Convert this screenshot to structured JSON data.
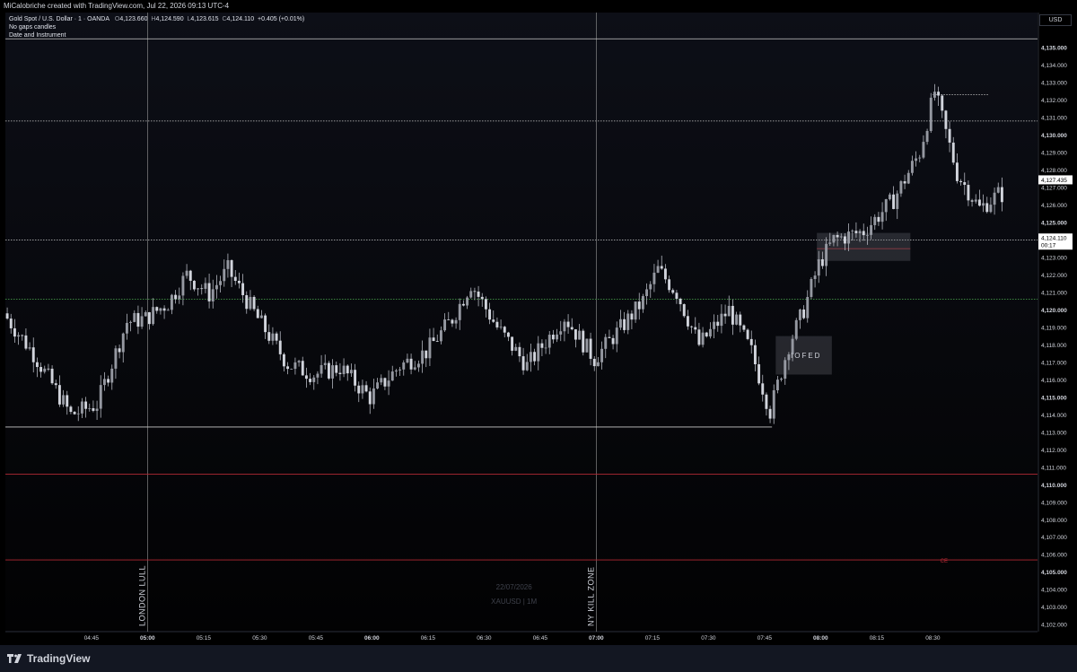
{
  "header": {
    "credit": "MiCalobriche created with TradingView.com, Jul 22, 2026 09:13 UTC-4"
  },
  "legend": {
    "symbol": "Gold Spot / U.S. Dollar · 1 · OANDA",
    "open_label": "O",
    "open": "4,123.660",
    "high_label": "H",
    "high": "4,124.590",
    "low_label": "L",
    "low": "4,123.615",
    "close_label": "C",
    "close": "4,124.110",
    "change": "+0.405 (+0.01%)",
    "line2": "No gaps candles",
    "line3": "Date and Instrument"
  },
  "price_axis": {
    "currency": "USD",
    "current_price": "4,124.110",
    "countdown": "00:17",
    "price_badge_a": "4,127.435",
    "price_badge_b": "4,127.435"
  },
  "footer": {
    "brand": "TradingView"
  },
  "colors": {
    "candle": "#b2b5be",
    "red_level": "#b22833",
    "green_level": "#4caf50",
    "white_level": "#c8c8c8"
  },
  "chart_data": {
    "type": "candlestick",
    "instrument": "XAUUSD",
    "timeframe": "1M",
    "date": "22/07/2026",
    "watermark_line1": "22/07/2026",
    "watermark_line2": "XAUUSD | 1M",
    "ylim": [
      4101.6,
      4137.0
    ],
    "xlim": [
      "04:22",
      "08:58"
    ],
    "y_ticks": [
      {
        "v": 4135,
        "label": "4,135.000",
        "bold": true
      },
      {
        "v": 4134,
        "label": "4,134.000"
      },
      {
        "v": 4133,
        "label": "4,133.000"
      },
      {
        "v": 4132,
        "label": "4,132.000"
      },
      {
        "v": 4131,
        "label": "4,131.000"
      },
      {
        "v": 4130,
        "label": "4,130.000",
        "bold": true
      },
      {
        "v": 4129,
        "label": "4,129.000"
      },
      {
        "v": 4128,
        "label": "4,128.000"
      },
      {
        "v": 4127,
        "label": "4,127.000"
      },
      {
        "v": 4126,
        "label": "4,126.000"
      },
      {
        "v": 4125,
        "label": "4,125.000",
        "bold": true
      },
      {
        "v": 4123,
        "label": "4,123.000"
      },
      {
        "v": 4122,
        "label": "4,122.000"
      },
      {
        "v": 4121,
        "label": "4,121.000"
      },
      {
        "v": 4120,
        "label": "4,120.000",
        "bold": true
      },
      {
        "v": 4119,
        "label": "4,119.000"
      },
      {
        "v": 4118,
        "label": "4,118.000"
      },
      {
        "v": 4117,
        "label": "4,117.000"
      },
      {
        "v": 4116,
        "label": "4,116.000"
      },
      {
        "v": 4115,
        "label": "4,115.000",
        "bold": true
      },
      {
        "v": 4114,
        "label": "4,114.000"
      },
      {
        "v": 4113,
        "label": "4,113.000"
      },
      {
        "v": 4112,
        "label": "4,112.000"
      },
      {
        "v": 4111,
        "label": "4,111.000"
      },
      {
        "v": 4110,
        "label": "4,110.000",
        "bold": true
      },
      {
        "v": 4109,
        "label": "4,109.000"
      },
      {
        "v": 4108,
        "label": "4,108.000"
      },
      {
        "v": 4107,
        "label": "4,107.000"
      },
      {
        "v": 4106,
        "label": "4,106.000"
      },
      {
        "v": 4105,
        "label": "4,105.000",
        "bold": true
      },
      {
        "v": 4104,
        "label": "4,104.000"
      },
      {
        "v": 4103,
        "label": "4,103.000"
      },
      {
        "v": 4102,
        "label": "4,102.000"
      }
    ],
    "x_ticks": [
      {
        "t": "04:45",
        "label": "04:45"
      },
      {
        "t": "05:00",
        "label": "05:00",
        "bold": true
      },
      {
        "t": "05:15",
        "label": "05:15"
      },
      {
        "t": "05:30",
        "label": "05:30"
      },
      {
        "t": "05:45",
        "label": "05:45"
      },
      {
        "t": "06:00",
        "label": "06:00",
        "bold": true
      },
      {
        "t": "06:15",
        "label": "06:15"
      },
      {
        "t": "06:30",
        "label": "06:30"
      },
      {
        "t": "06:45",
        "label": "06:45"
      },
      {
        "t": "07:00",
        "label": "07:00",
        "bold": true
      },
      {
        "t": "07:15",
        "label": "07:15"
      },
      {
        "t": "07:30",
        "label": "07:30"
      },
      {
        "t": "07:45",
        "label": "07:45"
      },
      {
        "t": "08:00",
        "label": "08:00",
        "bold": true
      },
      {
        "t": "08:15",
        "label": "08:15"
      },
      {
        "t": "08:30",
        "label": "08:30"
      }
    ],
    "horizontal_levels": [
      {
        "v": 4135.5,
        "color": "white",
        "from": "04:22",
        "to": "08:58"
      },
      {
        "v": 4130.8,
        "color": "white",
        "style": "dotted",
        "from": "04:22",
        "to": "08:58"
      },
      {
        "v": 4124.0,
        "color": "white",
        "style": "dotted",
        "from": "04:22",
        "to": "08:58"
      },
      {
        "v": 4120.6,
        "color": "green",
        "style": "dotted",
        "from": "04:22",
        "to": "08:58"
      },
      {
        "v": 4113.3,
        "color": "white",
        "from": "04:22",
        "to": "07:47"
      },
      {
        "v": 4110.6,
        "color": "red",
        "from": "04:22",
        "to": "08:58"
      },
      {
        "v": 4105.7,
        "color": "red",
        "from": "04:22",
        "to": "08:58"
      },
      {
        "v": 4132.3,
        "color": "white",
        "style": "dotted",
        "from": "08:30",
        "to": "08:45"
      },
      {
        "v": 4123.5,
        "color": "red",
        "from": "07:59",
        "to": "08:24"
      }
    ],
    "session_lines": [
      {
        "t": "05:00",
        "label": "LONDON LULL"
      },
      {
        "t": "07:00",
        "label": "NY KILL ZONE"
      }
    ],
    "boxes": [
      {
        "label": "IOFED",
        "t0": "07:48",
        "t1": "08:03",
        "v0": 4116.3,
        "v1": 4118.5
      },
      {
        "label": "",
        "t0": "07:59",
        "t1": "08:24",
        "v0": 4122.8,
        "v1": 4124.4
      }
    ],
    "annotations": [
      {
        "text": "CE",
        "t": "08:32",
        "v": 4105.7
      },
      {
        "text": "IOFED",
        "t": "07:52",
        "v": 4117.4
      }
    ],
    "anchor_points": [
      [
        "04:22",
        4119.8
      ],
      [
        "04:30",
        4117.5
      ],
      [
        "04:40",
        4114.0
      ],
      [
        "04:47",
        4114.6
      ],
      [
        "04:55",
        4119.3
      ],
      [
        "05:00",
        4119.5
      ],
      [
        "05:06",
        4120.4
      ],
      [
        "05:11",
        4122.0
      ],
      [
        "05:17",
        4120.9
      ],
      [
        "05:22",
        4122.3
      ],
      [
        "05:30",
        4119.5
      ],
      [
        "05:38",
        4116.9
      ],
      [
        "05:45",
        4116.3
      ],
      [
        "05:52",
        4116.7
      ],
      [
        "06:00",
        4115.0
      ],
      [
        "06:08",
        4116.8
      ],
      [
        "06:15",
        4117.6
      ],
      [
        "06:22",
        4119.5
      ],
      [
        "06:27",
        4121.5
      ],
      [
        "06:34",
        4119.0
      ],
      [
        "06:42",
        4116.8
      ],
      [
        "06:52",
        4119.6
      ],
      [
        "07:00",
        4117.2
      ],
      [
        "07:08",
        4119.2
      ],
      [
        "07:13",
        4120.5
      ],
      [
        "07:17",
        4122.3
      ],
      [
        "07:22",
        4121.0
      ],
      [
        "07:28",
        4118.0
      ],
      [
        "07:36",
        4120.0
      ],
      [
        "07:42",
        4117.6
      ],
      [
        "07:47",
        4114.2
      ],
      [
        "07:52",
        4118.0
      ],
      [
        "07:56",
        4120.0
      ],
      [
        "08:00",
        4122.6
      ],
      [
        "08:04",
        4124.0
      ],
      [
        "08:12",
        4124.5
      ],
      [
        "08:20",
        4126.3
      ],
      [
        "08:27",
        4129.0
      ],
      [
        "08:31",
        4132.5
      ],
      [
        "08:37",
        4127.8
      ],
      [
        "08:43",
        4125.8
      ],
      [
        "08:48",
        4126.6
      ]
    ]
  }
}
